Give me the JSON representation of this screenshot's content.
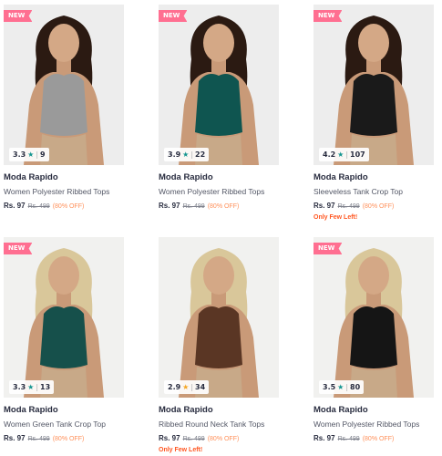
{
  "products": [
    {
      "badge": "NEW",
      "rating": "3.3",
      "count": "9",
      "star_color": "#14958f",
      "brand": "Moda Rapido",
      "title": "Women Polyester Ribbed Tops",
      "price": "Rs. 97",
      "mrp": "Rs. 499",
      "discount": "(80% OFF)",
      "note": "",
      "top_color": "#9a9a9a",
      "hair_color": "#2b1a12"
    },
    {
      "badge": "NEW",
      "rating": "3.9",
      "count": "22",
      "star_color": "#14958f",
      "brand": "Moda Rapido",
      "title": "Women Polyester Ribbed Tops",
      "price": "Rs. 97",
      "mrp": "Rs. 499",
      "discount": "(80% OFF)",
      "note": "",
      "top_color": "#0f5550",
      "hair_color": "#2b1a12"
    },
    {
      "badge": "NEW",
      "rating": "4.2",
      "count": "107",
      "star_color": "#14958f",
      "brand": "Moda Rapido",
      "title": "Sleeveless Tank Crop Top",
      "price": "Rs. 97",
      "mrp": "Rs. 499",
      "discount": "(80% OFF)",
      "note": "Only Few Left!",
      "top_color": "#1a1a1a",
      "hair_color": "#2b1a12"
    },
    {
      "badge": "NEW",
      "rating": "3.3",
      "count": "13",
      "star_color": "#14958f",
      "brand": "Moda Rapido",
      "title": "Women Green Tank Crop Top",
      "price": "Rs. 97",
      "mrp": "Rs. 499",
      "discount": "(80% OFF)",
      "note": "",
      "top_color": "#16504b",
      "hair_color": "#d9c79a"
    },
    {
      "badge": "",
      "rating": "2.9",
      "count": "34",
      "star_color": "#f5a623",
      "brand": "Moda Rapido",
      "title": "Ribbed Round Neck Tank Tops",
      "price": "Rs. 97",
      "mrp": "Rs. 499",
      "discount": "(80% OFF)",
      "note": "Only Few Left!",
      "top_color": "#5a3624",
      "hair_color": "#d9c79a"
    },
    {
      "badge": "NEW",
      "rating": "3.5",
      "count": "80",
      "star_color": "#14958f",
      "brand": "Moda Rapido",
      "title": "Women Polyester Ribbed Tops",
      "price": "Rs. 97",
      "mrp": "Rs. 499",
      "discount": "(80% OFF)",
      "note": "",
      "top_color": "#151515",
      "hair_color": "#d9c79a"
    }
  ]
}
